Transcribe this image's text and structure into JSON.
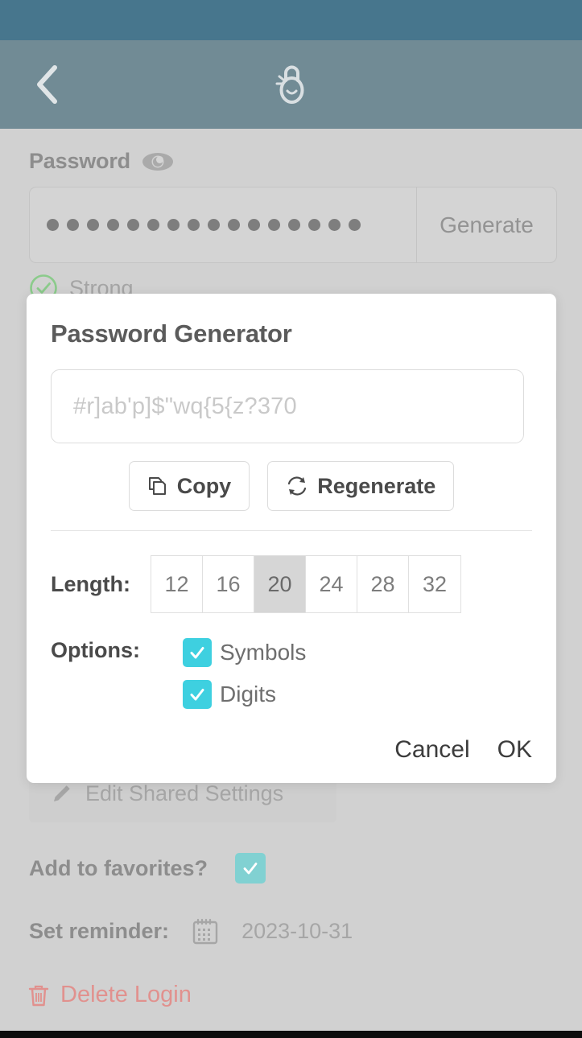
{
  "app": {
    "logo_icon": "padlock-smiley-icon",
    "back_icon": "chevron-left-icon",
    "status_bar_color": "#14506e",
    "app_bar_color": "#4a6b78"
  },
  "background_form": {
    "password": {
      "label": "Password",
      "reveal_icon": "eye-icon",
      "masked_value": "●●●●●●●●●●●●●●●●",
      "mask_dot_count": 16,
      "generate_label": "Generate"
    },
    "strength": {
      "icon": "check-circle-icon",
      "text": "Strong",
      "color": "#6bbd6b"
    },
    "shared_settings": {
      "icon": "pencil-icon",
      "label": "Edit Shared Settings"
    },
    "favorites": {
      "label": "Add to favorites?",
      "checked": true,
      "checkbox_color": "#5ec4c6",
      "check_icon": "check-icon"
    },
    "reminder": {
      "label": "Set reminder:",
      "icon": "calendar-icon",
      "date": "2023-10-31"
    },
    "delete": {
      "icon": "trash-icon",
      "label": "Delete Login",
      "color": "#d9736f"
    }
  },
  "modal": {
    "title": "Password Generator",
    "generated_password": "#r]ab'p]$\"wq{5{z?370",
    "actions": [
      {
        "label": "Copy",
        "icon": "copy-icon"
      },
      {
        "label": "Regenerate",
        "icon": "refresh-icon"
      }
    ],
    "length": {
      "label": "Length:",
      "options": [
        "12",
        "16",
        "20",
        "24",
        "28",
        "32"
      ],
      "selected": "20"
    },
    "options": {
      "label": "Options:",
      "items": [
        {
          "label": "Symbols",
          "checked": true
        },
        {
          "label": "Digits",
          "checked": true
        }
      ],
      "checkbox_color": "#3ed0e0",
      "check_icon": "check-icon"
    },
    "footer": {
      "cancel_label": "Cancel",
      "ok_label": "OK"
    }
  }
}
